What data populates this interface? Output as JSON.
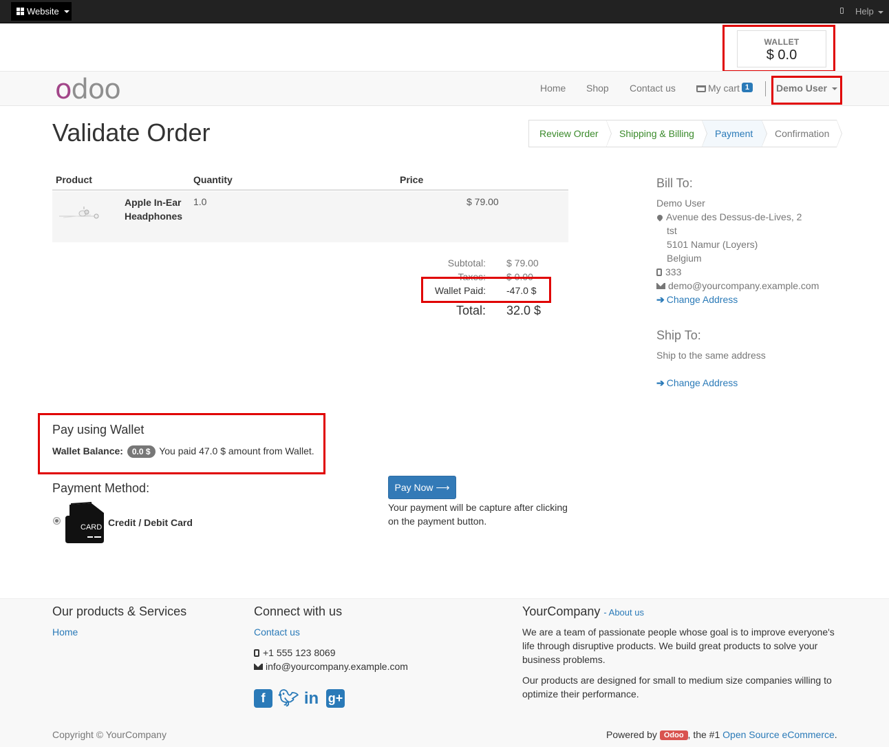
{
  "adminbar": {
    "website_label": "Website",
    "help_label": "Help"
  },
  "wallet_widget": {
    "label": "WALLET",
    "amount": "$ 0.0"
  },
  "navbar": {
    "logo": "odoo",
    "items": [
      {
        "label": "Home"
      },
      {
        "label": "Shop"
      },
      {
        "label": "Contact us"
      },
      {
        "label": "My cart"
      }
    ],
    "cart_count": "1",
    "user": "Demo User"
  },
  "page": {
    "title": "Validate Order"
  },
  "wizard": {
    "steps": [
      {
        "label": "Review Order",
        "state": "done"
      },
      {
        "label": "Shipping & Billing",
        "state": "done"
      },
      {
        "label": "Payment",
        "state": "active"
      },
      {
        "label": "Confirmation",
        "state": "todo"
      }
    ]
  },
  "order_table": {
    "headers": {
      "product": "Product",
      "quantity": "Quantity",
      "price": "Price"
    },
    "rows": [
      {
        "name": "Apple In-Ear Headphones",
        "quantity": "1.0",
        "price": "$ 79.00"
      }
    ]
  },
  "totals": {
    "subtotal_label": "Subtotal:",
    "subtotal": "$ 79.00",
    "taxes_label": "Taxes:",
    "taxes": "$ 0.00",
    "wallet_paid_label": "Wallet Paid:",
    "wallet_paid": "-47.0 $",
    "total_label": "Total:",
    "total": "32.0 $"
  },
  "bill_to": {
    "title": "Bill To:",
    "name": "Demo User",
    "street": "Avenue des Dessus-de-Lives, 2",
    "street2": "tst",
    "city": "5101 Namur (Loyers)",
    "country": "Belgium",
    "phone": "333",
    "email": "demo@yourcompany.example.com",
    "change_address": "Change Address"
  },
  "ship_to": {
    "title": "Ship To:",
    "text": "Ship to the same address",
    "change_address": "Change Address"
  },
  "wallet_pay": {
    "title": "Pay using Wallet",
    "balance_label": "Wallet Balance:",
    "balance": "0.0 $",
    "message": "You paid 47.0 $ amount from Wallet."
  },
  "payment": {
    "title": "Payment Method:",
    "method_label": "Credit / Debit Card",
    "card_text": "CARD",
    "pay_button": "Pay Now",
    "note": "Your payment will be capture after clicking on the payment button."
  },
  "footer": {
    "products_title": "Our products & Services",
    "products_links": [
      "Home"
    ],
    "connect_title": "Connect with us",
    "connect_link": "Contact us",
    "phone": "+1 555 123 8069",
    "email": "info@yourcompany.example.com",
    "company_title": "YourCompany",
    "about_link": "- About us",
    "about_p1": "We are a team of passionate people whose goal is to improve everyone's life through disruptive products. We build great products to solve your business problems.",
    "about_p2": "Our products are designed for small to medium size companies willing to optimize their performance.",
    "copyright": "Copyright © YourCompany",
    "powered_by": "Powered by",
    "odoo_badge": "Odoo",
    "powered_mid": ", the #1",
    "powered_link": "Open Source eCommerce",
    "powered_end": "."
  },
  "colors": {
    "primary": "#337ab7",
    "link": "#2a7ab8",
    "highlight_box": "#e00000",
    "step_done": "#3a8a2a",
    "odoo_purple": "#a24689"
  }
}
